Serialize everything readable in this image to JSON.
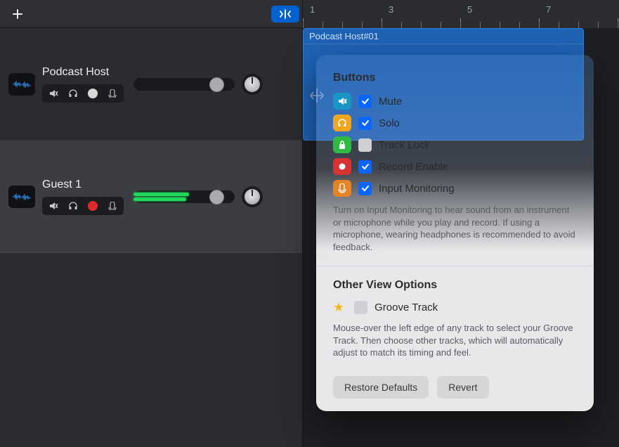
{
  "ruler": {
    "marks": [
      "1",
      "3",
      "5",
      "7"
    ]
  },
  "tracks": [
    {
      "name": "Podcast Host",
      "record_enabled": false,
      "selected": false,
      "volume_thumb_pct": 75,
      "meter_pct": 0
    },
    {
      "name": "Guest 1",
      "record_enabled": true,
      "selected": true,
      "volume_thumb_pct": 75,
      "meter_pct": 55
    }
  ],
  "region": {
    "title": "Podcast Host#01"
  },
  "popover": {
    "section_buttons": "Buttons",
    "items": [
      {
        "key": "mute",
        "label": "Mute",
        "checked": true,
        "color": "pic-mute"
      },
      {
        "key": "solo",
        "label": "Solo",
        "checked": true,
        "color": "pic-solo"
      },
      {
        "key": "lock",
        "label": "Track Lock",
        "checked": false,
        "color": "pic-lock"
      },
      {
        "key": "rec",
        "label": "Record Enable",
        "checked": true,
        "color": "pic-rec"
      },
      {
        "key": "mon",
        "label": "Input Monitoring",
        "checked": true,
        "color": "pic-mon"
      }
    ],
    "buttons_desc": "Turn on Input Monitoring to hear sound from an instrument or microphone while you play and record. If using a microphone, wearing headphones is recommended to avoid feedback.",
    "section_other": "Other View Options",
    "groove": {
      "label": "Groove Track",
      "checked": false
    },
    "groove_desc": "Mouse-over the left edge of any track to select your Groove Track. Then choose other tracks, which will automatically adjust to match its timing and feel.",
    "restore_btn": "Restore Defaults",
    "revert_btn": "Revert"
  }
}
